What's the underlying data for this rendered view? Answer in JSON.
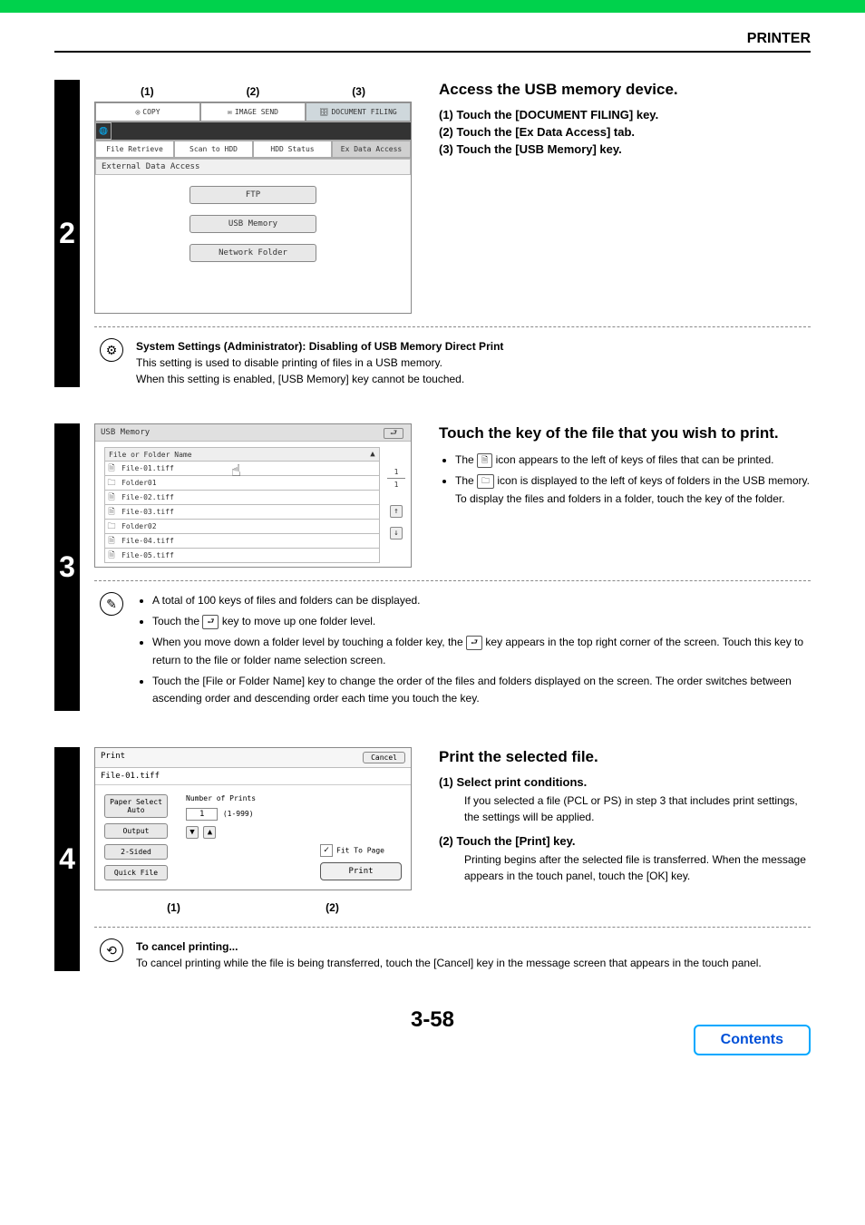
{
  "header": {
    "title": "PRINTER"
  },
  "step2": {
    "num": "2",
    "labels": {
      "c1": "(1)",
      "c2": "(2)",
      "c3": "(3)"
    },
    "tabs": {
      "copy": "COPY",
      "imagesend": "IMAGE SEND",
      "docfiling": "DOCUMENT FILING"
    },
    "row2": {
      "fileretrieve": "File Retrieve",
      "scanhdd": "Scan to HDD",
      "hddstatus": "HDD Status",
      "exdata": "Ex Data Access"
    },
    "bar": "External Data Access",
    "buttons": {
      "ftp": "FTP",
      "usb": "USB Memory",
      "net": "Network Folder"
    },
    "heading": "Access the USB memory device.",
    "s1": "(1)  Touch the [DOCUMENT FILING] key.",
    "s2": "(2)  Touch the [Ex Data Access] tab.",
    "s3": "(3)  Touch the [USB Memory] key.",
    "note_title": "System Settings (Administrator): Disabling of USB Memory Direct Print",
    "note_l1": "This setting is used to disable printing of files in a USB memory.",
    "note_l2": "When this setting is enabled, [USB Memory] key cannot be touched."
  },
  "step3": {
    "num": "3",
    "title": "USB Memory",
    "header_row": "File or Folder Name",
    "files": [
      {
        "icon": "file",
        "name": "File-01.tiff"
      },
      {
        "icon": "folder",
        "name": "Folder01"
      },
      {
        "icon": "file",
        "name": "File-02.tiff"
      },
      {
        "icon": "file",
        "name": "File-03.tiff"
      },
      {
        "icon": "folder",
        "name": "Folder02"
      },
      {
        "icon": "file",
        "name": "File-04.tiff"
      },
      {
        "icon": "file",
        "name": "File-05.tiff"
      }
    ],
    "page_num_top": "1",
    "page_num_bot": "1",
    "heading": "Touch the key of the file that you wish to print.",
    "b1a": "The ",
    "b1b": " icon appears to the left of keys of files that can be printed.",
    "b2a": "The ",
    "b2b": " icon is displayed to the left of keys of folders in the USB memory. To display the files and folders in a folder, touch the key of the folder.",
    "n1": "A total of 100 keys of files and folders can be displayed.",
    "n2a": "Touch the ",
    "n2b": " key to move up one folder level.",
    "n3a": "When you move down a folder level by touching a folder key, the ",
    "n3b": " key appears in the top right corner of the screen. Touch this key to return to the file or folder name selection screen.",
    "n4": "Touch the [File or Folder Name] key to change the order of the files and folders displayed on the screen. The order switches between ascending order and descending order each time you touch the key."
  },
  "step4": {
    "num": "4",
    "print_label": "Print",
    "cancel": "Cancel",
    "filename": "File-01.tiff",
    "paper_select": "Paper Select",
    "auto": "Auto",
    "output": "Output",
    "twosided": "2-Sided",
    "quickfile": "Quick File",
    "numprints": "Number of Prints",
    "count": "1",
    "range": "(1-999)",
    "fit": "Fit To Page",
    "printbtn": "Print",
    "c1": "(1)",
    "c2": "(2)",
    "heading": "Print the selected file.",
    "s1": "(1)  Select print conditions.",
    "s1b": "If you selected a file (PCL or PS) in step 3 that includes print settings, the settings will be applied.",
    "s2": "(2)  Touch the [Print] key.",
    "s2b": "Printing begins after the selected file is transferred. When the message appears in the touch panel, touch the [OK] key.",
    "note_title": "To cancel printing...",
    "note_body": "To cancel printing while the file is being transferred, touch the [Cancel] key in the message screen that appears in the touch panel."
  },
  "footer": {
    "pagenum": "3-58",
    "contents": "Contents"
  }
}
